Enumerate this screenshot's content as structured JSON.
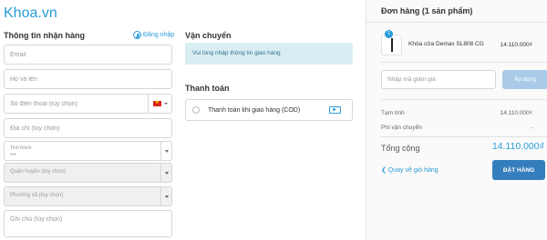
{
  "brand": {
    "logo": "Khoa.vn"
  },
  "shipping_info": {
    "title": "Thông tin nhận hàng",
    "login_label": "Đăng nhập",
    "email_placeholder": "Email",
    "name_placeholder": "Họ và tên",
    "phone_placeholder": "Số điện thoại (tùy chọn)",
    "address_placeholder": "Địa chỉ (tùy chọn)",
    "province_label": "Tỉnh thành",
    "province_value": "---",
    "district_placeholder": "Quận huyện (tùy chọn)",
    "ward_placeholder": "Phường xã (tùy chọn)",
    "note_placeholder": "Ghi chú (tùy chọn)"
  },
  "shipping": {
    "title": "Vận chuyển",
    "notice": "Vui lòng nhập thông tin giao hàng"
  },
  "payment": {
    "title": "Thanh toán",
    "cod_label": "Thanh toán khi giao hàng (COD)"
  },
  "order": {
    "title": "Đơn hàng (1 sản phẩm)",
    "item": {
      "qty": "1",
      "name": "Khóa cửa Demax SL808 CG",
      "price": "14.110.000₫"
    },
    "discount_placeholder": "Nhập mã giảm giá",
    "apply_label": "Áp dụng",
    "subtotal_label": "Tạm tính",
    "subtotal_value": "14.110.000₫",
    "shipping_label": "Phí vận chuyển",
    "shipping_value": "-",
    "total_label": "Tổng cộng",
    "total_value": "14.110.000₫",
    "back_label": "❮ Quay về giỏ hàng",
    "submit_label": "ĐẶT HÀNG"
  },
  "colors": {
    "accent": "#2a9dd8",
    "primary_button": "#357ebd",
    "apply_button": "#a9cbe9",
    "notice_bg": "#d9eef2"
  }
}
